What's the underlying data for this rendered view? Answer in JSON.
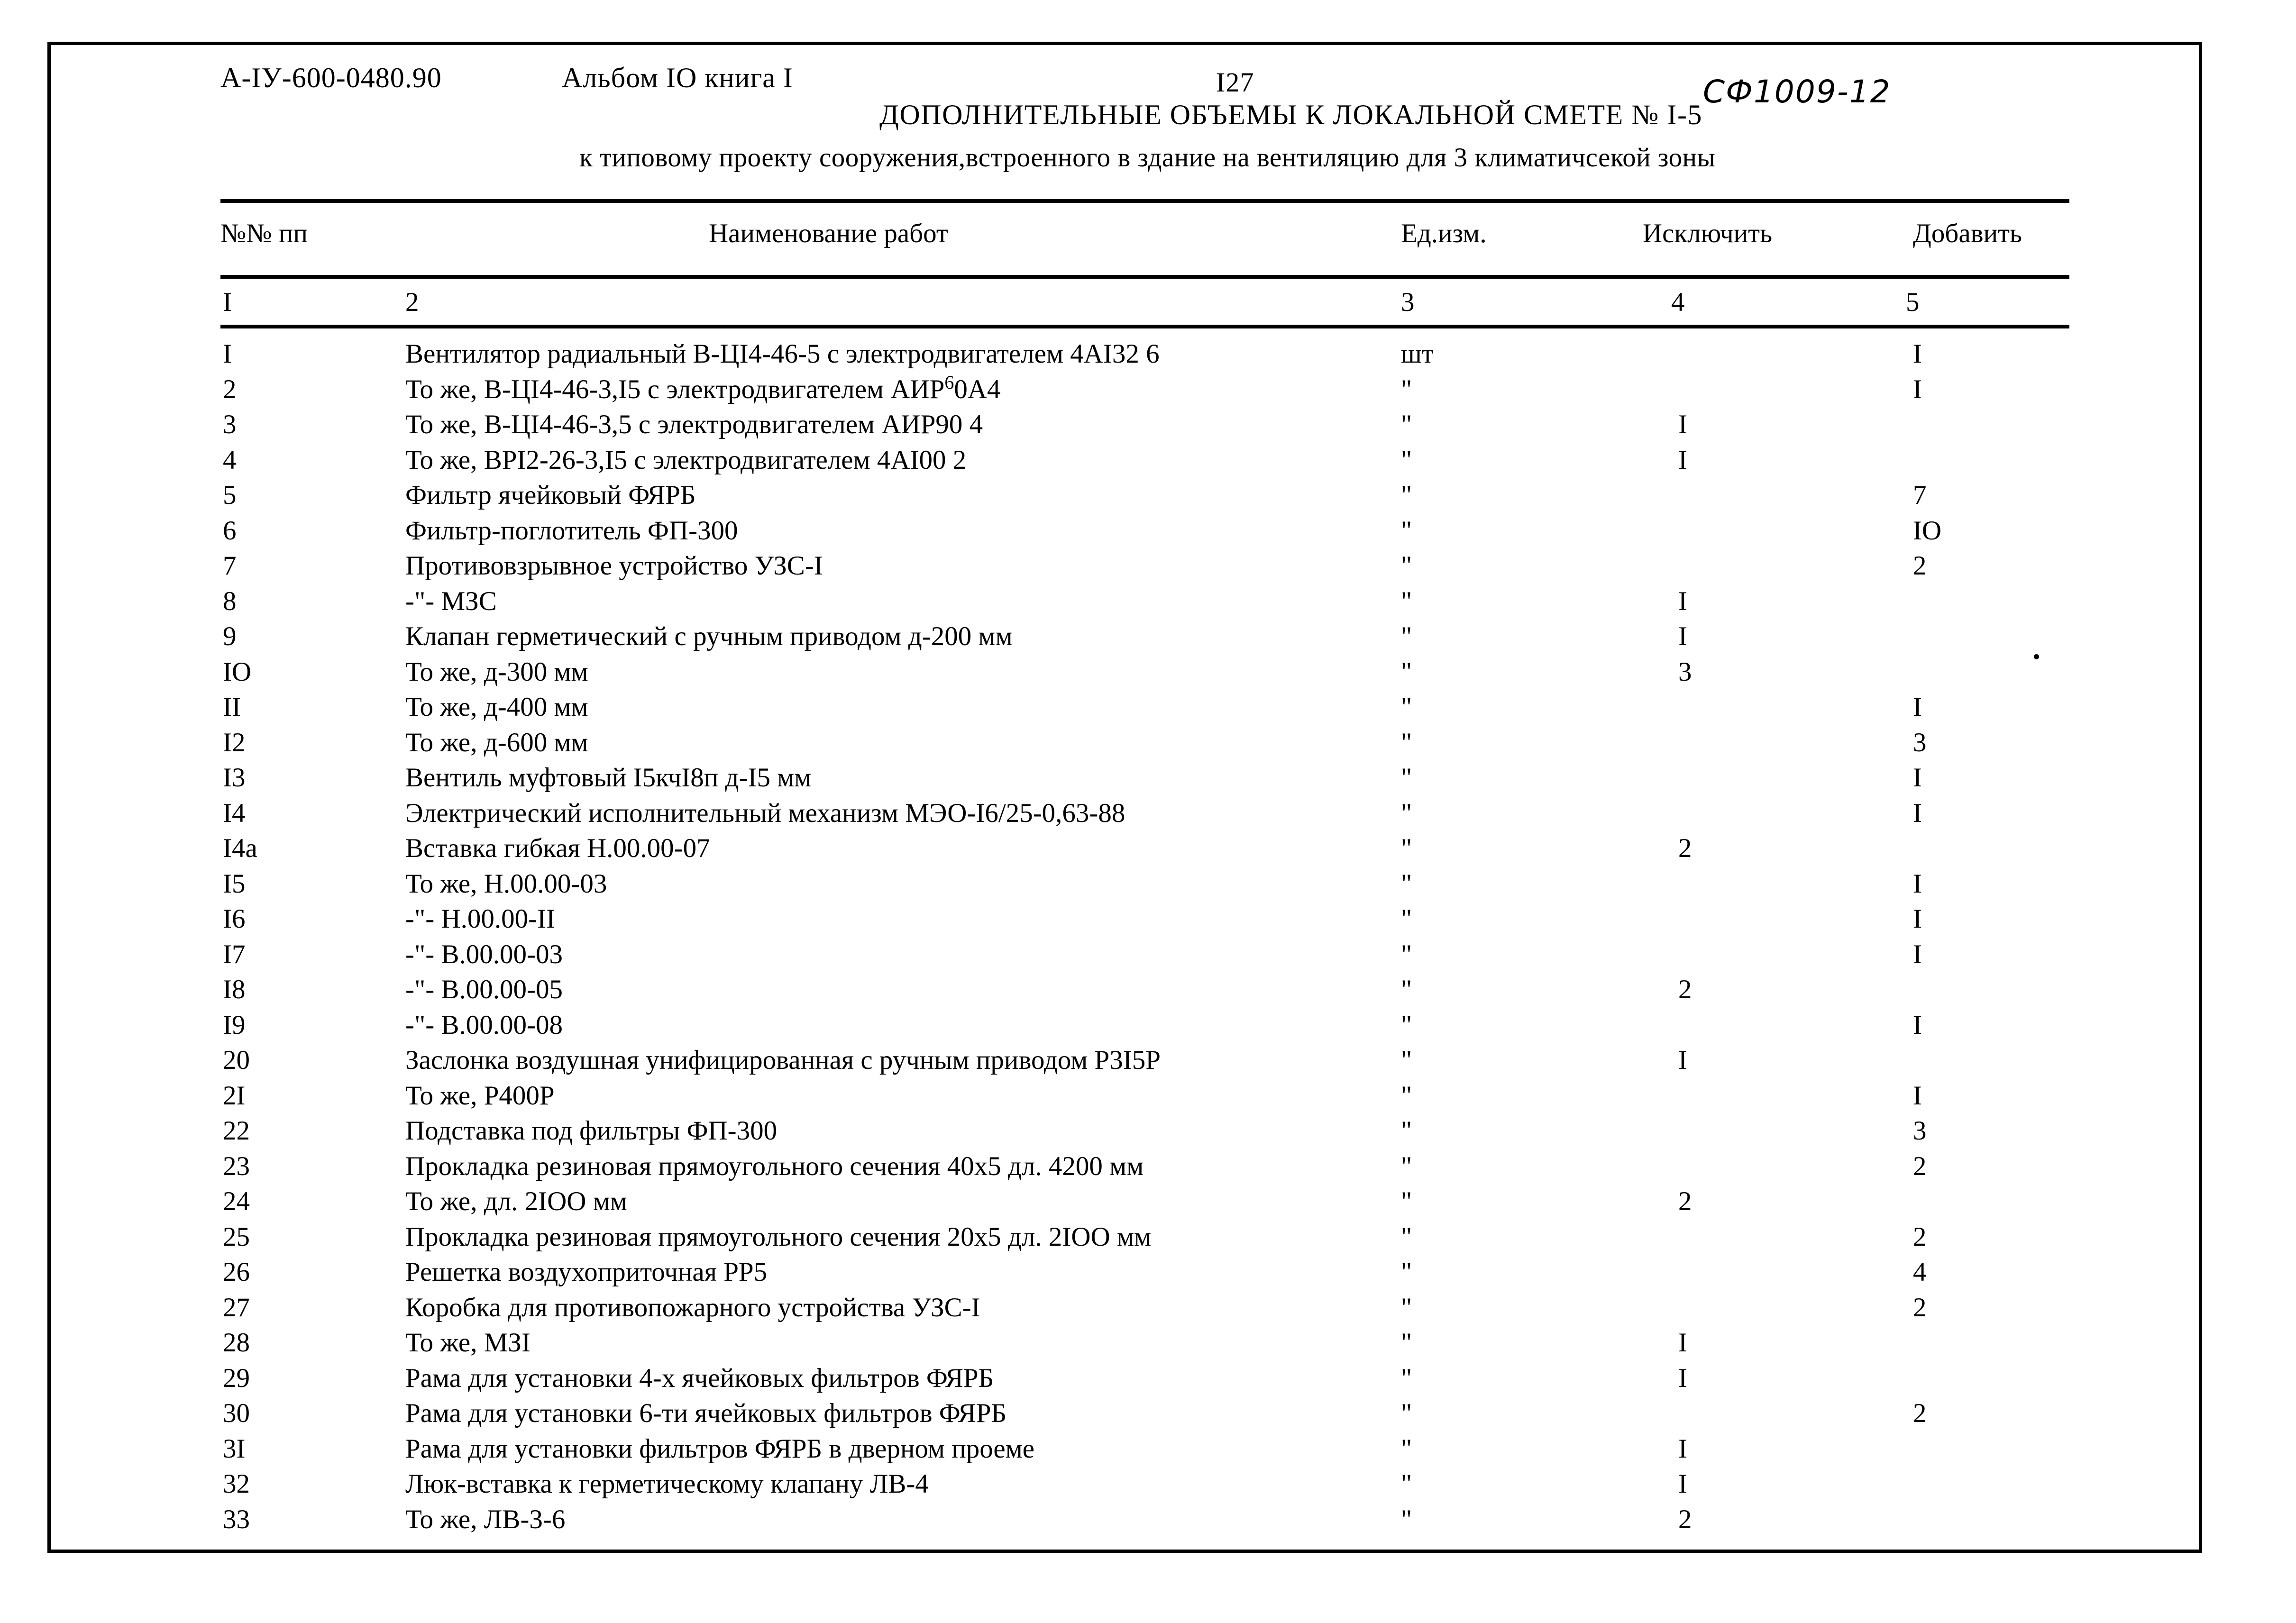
{
  "header": {
    "doc_code": "А-IУ-600-0480.90",
    "album_info": "Альбом IО книга I",
    "page_number": "I27",
    "hand_note": "СФ1009-12",
    "title_main": "ДОПОЛНИТЕЛЬНЫЕ ОБЪЕМЫ К ЛОКАЛЬНОЙ СМЕТЕ № I-5",
    "title_sub": "к типовому проекту сооружения,встроенного в здание на вентиляцию для 3 климатичсекой зоны"
  },
  "table": {
    "columns": [
      {
        "label": "№№ пп",
        "number": "I"
      },
      {
        "label": "Наименование работ",
        "number": "2"
      },
      {
        "label": "Ед.изм.",
        "number": "3"
      },
      {
        "label": "Исключить",
        "number": "4"
      },
      {
        "label": "Добавить",
        "number": "5"
      }
    ],
    "rows": [
      {
        "no": "I",
        "name": "Вентилятор радиальный В-ЦI4-46-5 с электродвигателем 4AI32 6",
        "unit": "шт",
        "exclude": "",
        "add": "I"
      },
      {
        "no": "2",
        "name_pre": "То же, В-ЦI4-46-3,I5 с электродвигателем АИР",
        "name_sup": "6",
        "name_post": "0А4",
        "unit": "\"",
        "exclude": "",
        "add": "I"
      },
      {
        "no": "3",
        "name": "То же, В-ЦI4-46-3,5 с электродвигателем АИР90 4",
        "unit": "\"",
        "exclude": "I",
        "add": ""
      },
      {
        "no": "4",
        "name": "То же, ВРI2-26-3,I5 с электродвигателем 4AI00 2",
        "unit": "\"",
        "exclude": "I",
        "add": ""
      },
      {
        "no": "5",
        "name": "Фильтр ячейковый ФЯРБ",
        "unit": "\"",
        "exclude": "",
        "add": "7"
      },
      {
        "no": "6",
        "name": "Фильтр-поглотитель ФП-300",
        "unit": "\"",
        "exclude": "",
        "add": "IО"
      },
      {
        "no": "7",
        "name": "Противовзрывное устройство УЗС-I",
        "unit": "\"",
        "exclude": "",
        "add": "2"
      },
      {
        "no": "8",
        "name": "-\"- МЗС",
        "unit": "\"",
        "exclude": "I",
        "add": ""
      },
      {
        "no": "9",
        "name": "Клапан герметический с ручным приводом д-200 мм",
        "unit": "\"",
        "exclude": "I",
        "add": ""
      },
      {
        "no": "IО",
        "name": "То же, д-300 мм",
        "unit": "\"",
        "exclude": "3",
        "add": ""
      },
      {
        "no": "II",
        "name": "То же, д-400 мм",
        "unit": "\"",
        "exclude": "",
        "add": "I"
      },
      {
        "no": "I2",
        "name": "То же, д-600 мм",
        "unit": "\"",
        "exclude": "",
        "add": "3"
      },
      {
        "no": "I3",
        "name": "Вентиль муфтовый I5кчI8п д-I5 мм",
        "unit": "\"",
        "exclude": "",
        "add": "I"
      },
      {
        "no": "I4",
        "name": "Электрический исполнительный механизм МЭО-I6/25-0,63-88",
        "unit": "\"",
        "exclude": "",
        "add": "I"
      },
      {
        "no": "I4а",
        "name": "Вставка гибкая Н.00.00-07",
        "unit": "\"",
        "exclude": "2",
        "add": ""
      },
      {
        "no": "I5",
        "name": "То же, Н.00.00-03",
        "unit": "\"",
        "exclude": "",
        "add": "I"
      },
      {
        "no": "I6",
        "name": "-\"-    Н.00.00-II",
        "unit": "\"",
        "exclude": "",
        "add": "I"
      },
      {
        "no": "I7",
        "name": "-\"-    В.00.00-03",
        "unit": "\"",
        "exclude": "",
        "add": "I"
      },
      {
        "no": "I8",
        "name": "-\"-    В.00.00-05",
        "unit": "\"",
        "exclude": "2",
        "add": ""
      },
      {
        "no": "I9",
        "name": "-\"-    В.00.00-08",
        "unit": "\"",
        "exclude": "",
        "add": "I"
      },
      {
        "no": "20",
        "name": "Заслонка воздушная унифицированная с ручным приводом Р3I5Р",
        "unit": "\"",
        "exclude": "I",
        "add": ""
      },
      {
        "no": "2I",
        "name": "То же, Р400Р",
        "unit": "\"",
        "exclude": "",
        "add": "I"
      },
      {
        "no": "22",
        "name": "Подставка под фильтры ФП-300",
        "unit": "\"",
        "exclude": "",
        "add": "3"
      },
      {
        "no": "23",
        "name": "Прокладка резиновая прямоугольного сечения 40х5 дл. 4200 мм",
        "unit": "\"",
        "exclude": "",
        "add": "2"
      },
      {
        "no": "24",
        "name": "То же, дл. 2IОО мм",
        "unit": "\"",
        "exclude": "2",
        "add": ""
      },
      {
        "no": "25",
        "name": "Прокладка резиновая прямоугольного сечения 20х5 дл. 2IОО мм",
        "unit": "\"",
        "exclude": "",
        "add": "2"
      },
      {
        "no": "26",
        "name": "Решетка воздухоприточная РР5",
        "unit": "\"",
        "exclude": "",
        "add": "4"
      },
      {
        "no": "27",
        "name": "Коробка для противопожарного устройства УЗС-I",
        "unit": "\"",
        "exclude": "",
        "add": "2"
      },
      {
        "no": "28",
        "name": "То же, МЗI",
        "unit": "\"",
        "exclude": "I",
        "add": ""
      },
      {
        "no": "29",
        "name": "Рама для установки 4-х ячейковых фильтров ФЯРБ",
        "unit": "\"",
        "exclude": "I",
        "add": ""
      },
      {
        "no": "30",
        "name": "Рама для установки 6-ти ячейковых фильтров ФЯРБ",
        "unit": "\"",
        "exclude": "",
        "add": "2"
      },
      {
        "no": "3I",
        "name": "Рама для установки фильтров ФЯРБ в дверном проеме",
        "unit": "\"",
        "exclude": "I",
        "add": ""
      },
      {
        "no": "32",
        "name": "Люк-вставка к герметическому клапану ЛВ-4",
        "unit": "\"",
        "exclude": "I",
        "add": ""
      },
      {
        "no": "33",
        "name": "То же, ЛВ-3-6",
        "unit": "\"",
        "exclude": "2",
        "add": ""
      }
    ]
  }
}
